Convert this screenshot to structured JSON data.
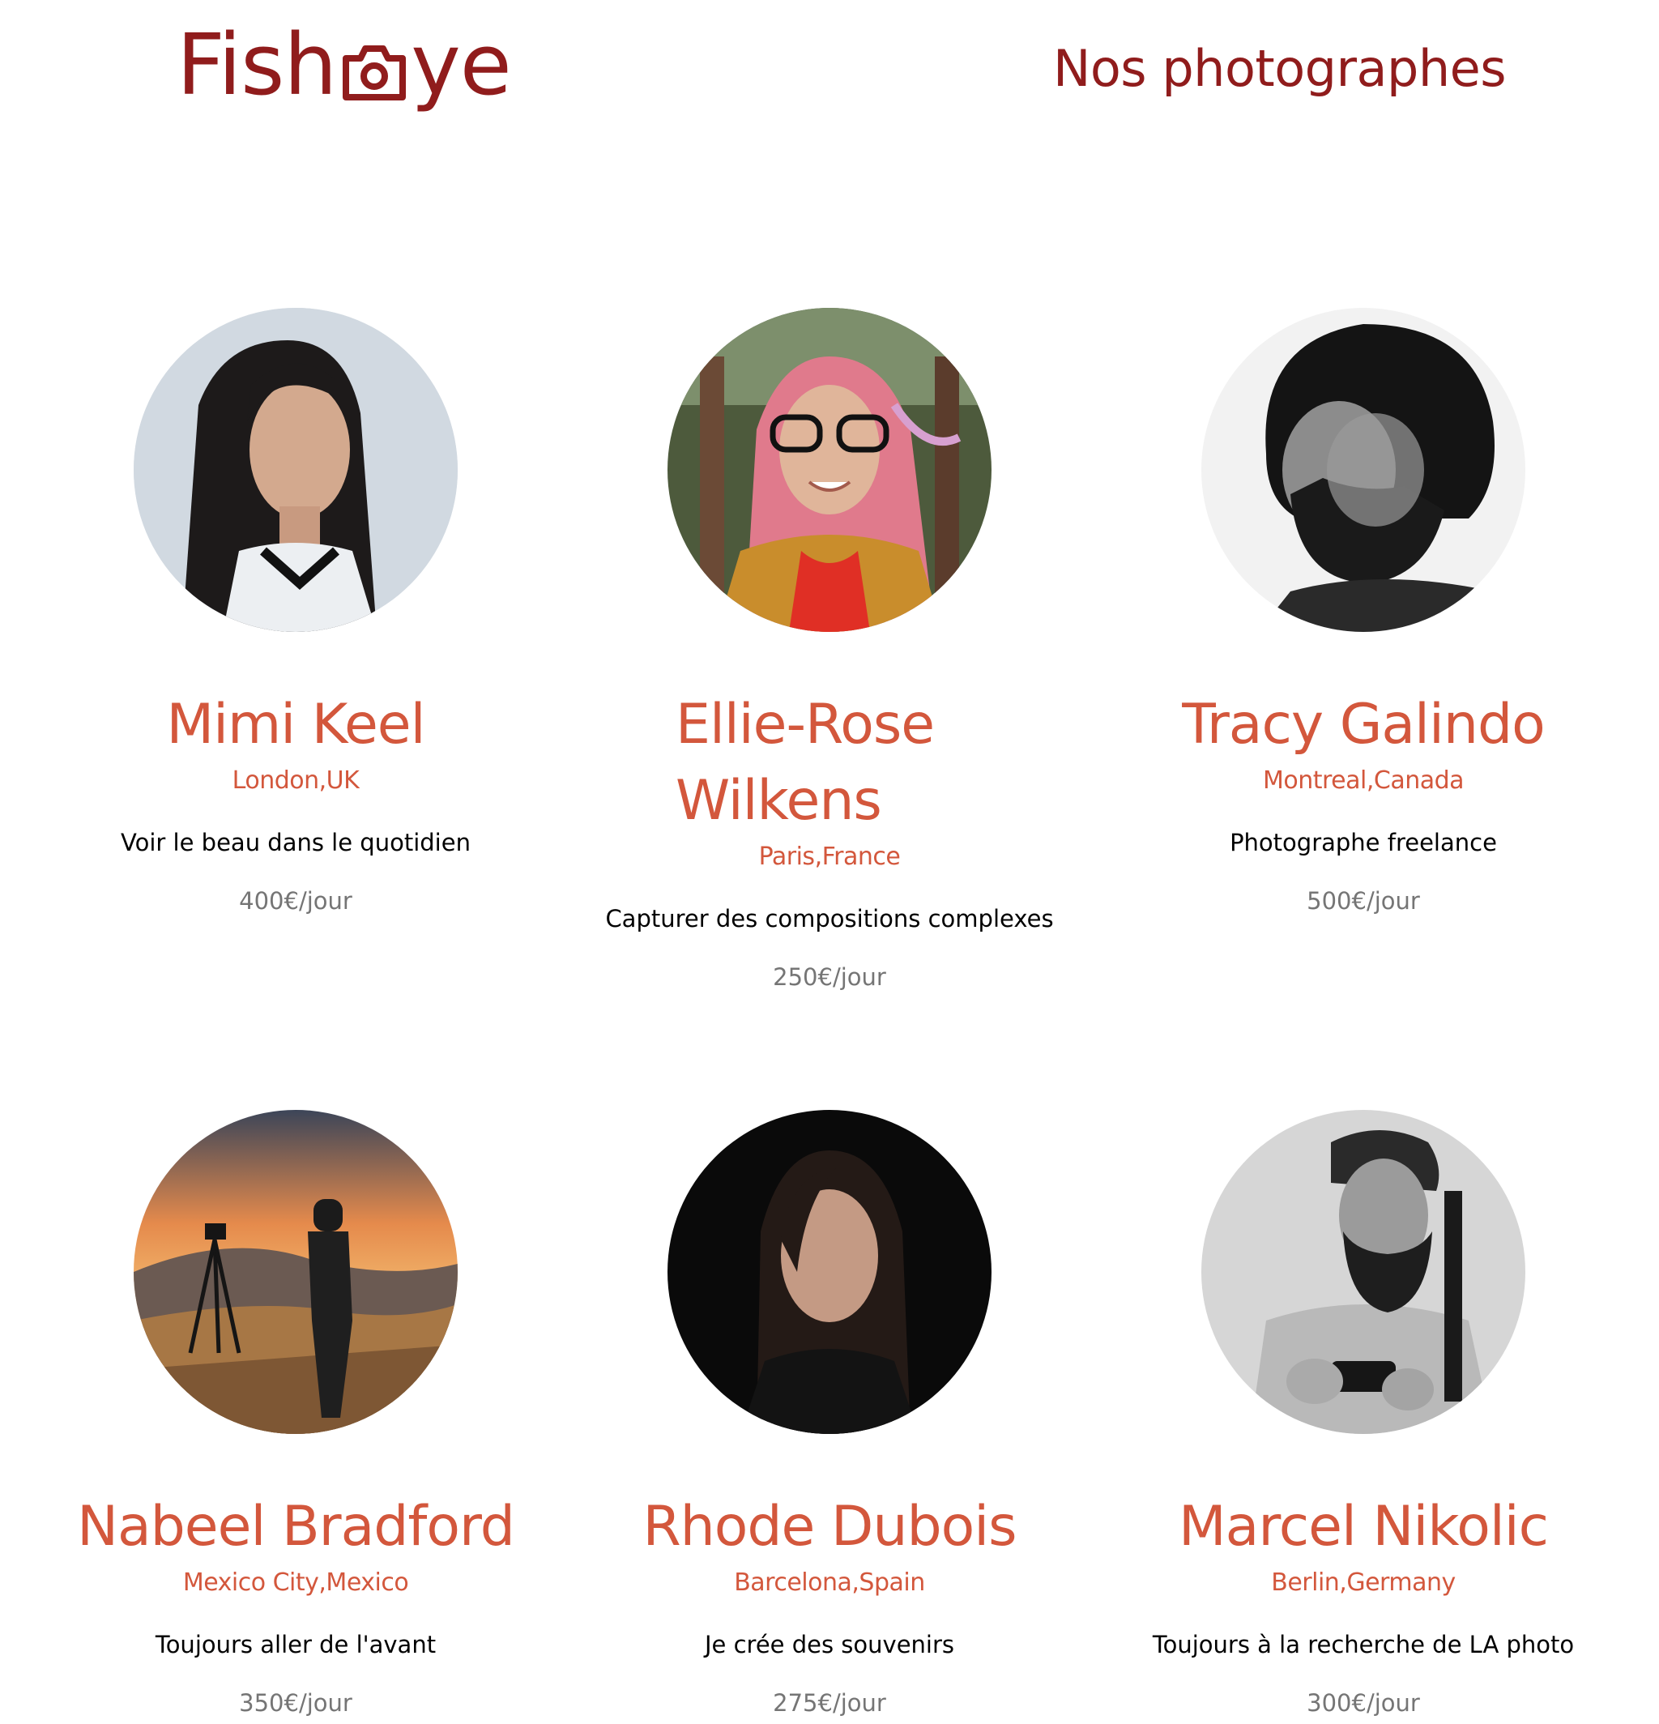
{
  "header": {
    "logo_text_left": "Fish",
    "logo_text_right": "ye",
    "logo_icon": "camera-icon",
    "page_title": "Nos photographes"
  },
  "colors": {
    "brand_dark": "#901c1c",
    "accent": "#d3573c",
    "price_grey": "#757575",
    "tagline": "#000000"
  },
  "photographers": [
    {
      "name": "Mimi Keel",
      "location": "London,UK",
      "tagline": "Voir le beau dans le quotidien",
      "price": "400€/jour"
    },
    {
      "name": "Ellie-Rose Wilkens",
      "location": "Paris,France",
      "tagline": "Capturer des compositions complexes",
      "price": "250€/jour"
    },
    {
      "name": "Tracy Galindo",
      "location": "Montreal,Canada",
      "tagline": "Photographe freelance",
      "price": "500€/jour"
    },
    {
      "name": "Nabeel Bradford",
      "location": "Mexico City,Mexico",
      "tagline": "Toujours aller de l'avant",
      "price": "350€/jour"
    },
    {
      "name": "Rhode Dubois",
      "location": "Barcelona,Spain",
      "tagline": "Je crée des souvenirs",
      "price": "275€/jour"
    },
    {
      "name": "Marcel Nikolic",
      "location": "Berlin,Germany",
      "tagline": "Toujours à la recherche de LA photo",
      "price": "300€/jour"
    }
  ]
}
